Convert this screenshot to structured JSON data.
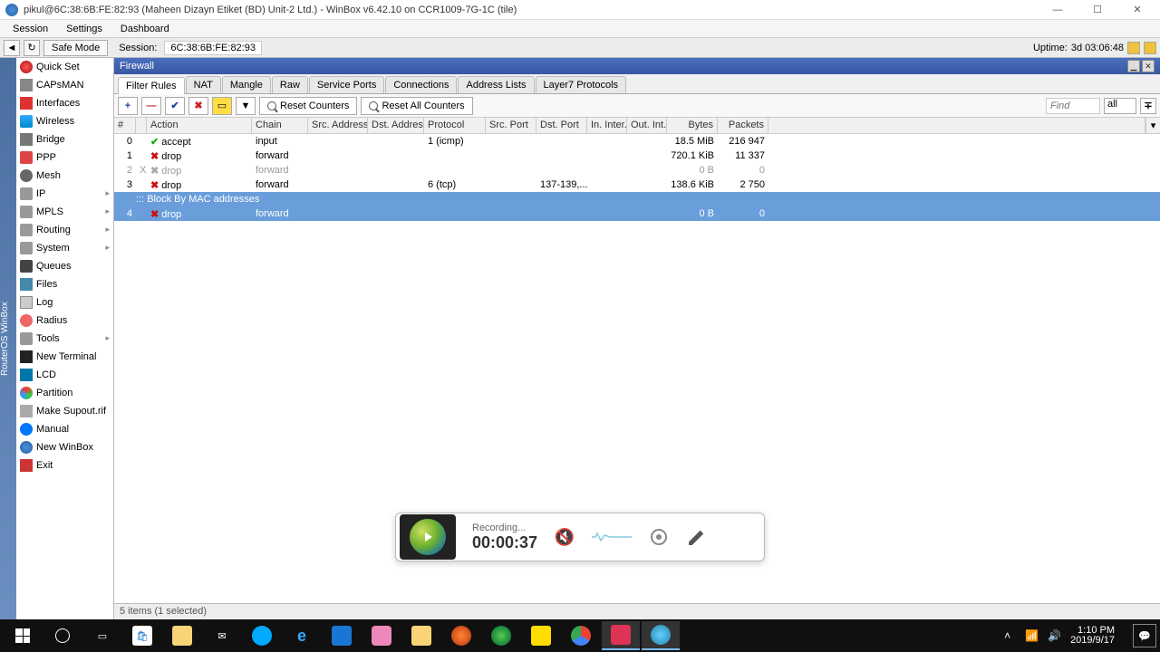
{
  "titlebar": {
    "text": "pikul@6C:38:6B:FE:82:93 (Maheen Dizayn Etiket (BD) Unit-2 Ltd.) - WinBox v6.42.10 on CCR1009-7G-1C (tile)"
  },
  "menu": {
    "session": "Session",
    "settings": "Settings",
    "dashboard": "Dashboard"
  },
  "session": {
    "safemode": "Safe Mode",
    "label": "Session:",
    "value": "6C:38:6B:FE:82:93",
    "uptime_label": "Uptime:",
    "uptime_value": "3d 03:06:48"
  },
  "vert_label": "RouterOS  WinBox",
  "sidebar": {
    "items": [
      {
        "label": "Quick Set",
        "cls": "ico-qset"
      },
      {
        "label": "CAPsMAN",
        "cls": "ico-caps"
      },
      {
        "label": "Interfaces",
        "cls": "ico-intf"
      },
      {
        "label": "Wireless",
        "cls": "ico-wifi"
      },
      {
        "label": "Bridge",
        "cls": "ico-bridge"
      },
      {
        "label": "PPP",
        "cls": "ico-ppp"
      },
      {
        "label": "Mesh",
        "cls": "ico-mesh"
      },
      {
        "label": "IP",
        "cls": "ico-ip",
        "arrow": true
      },
      {
        "label": "MPLS",
        "cls": "ico-mpls",
        "arrow": true
      },
      {
        "label": "Routing",
        "cls": "ico-routing",
        "arrow": true
      },
      {
        "label": "System",
        "cls": "ico-system",
        "arrow": true
      },
      {
        "label": "Queues",
        "cls": "ico-queue"
      },
      {
        "label": "Files",
        "cls": "ico-files"
      },
      {
        "label": "Log",
        "cls": "ico-log"
      },
      {
        "label": "Radius",
        "cls": "ico-radius"
      },
      {
        "label": "Tools",
        "cls": "ico-tools",
        "arrow": true
      },
      {
        "label": "New Terminal",
        "cls": "ico-term"
      },
      {
        "label": "LCD",
        "cls": "ico-lcd"
      },
      {
        "label": "Partition",
        "cls": "ico-part"
      },
      {
        "label": "Make Supout.rif",
        "cls": "ico-supout"
      },
      {
        "label": "Manual",
        "cls": "ico-manual"
      },
      {
        "label": "New WinBox",
        "cls": "ico-newwb"
      },
      {
        "label": "Exit",
        "cls": "ico-exit"
      }
    ]
  },
  "firewall": {
    "title": "Firewall",
    "tabs": [
      "Filter Rules",
      "NAT",
      "Mangle",
      "Raw",
      "Service Ports",
      "Connections",
      "Address Lists",
      "Layer7 Protocols"
    ],
    "active_tab": 0,
    "toolbar": {
      "reset": "Reset Counters",
      "reset_all": "Reset All Counters",
      "find_ph": "Find",
      "all": "all"
    },
    "columns": [
      "#",
      "",
      "Action",
      "Chain",
      "Src. Address",
      "Dst. Address",
      "Protocol",
      "Src. Port",
      "Dst. Port",
      "In. Inter...",
      "Out. Int...",
      "Bytes",
      "Packets"
    ],
    "rows": [
      {
        "num": "0",
        "x": "",
        "act": "accept",
        "chain": "input",
        "saddr": "",
        "daddr": "",
        "proto": "1 (icmp)",
        "sport": "",
        "dport": "",
        "inif": "",
        "outif": "",
        "bytes": "18.5 MiB",
        "packets": "216 947",
        "disabled": false
      },
      {
        "num": "1",
        "x": "",
        "act": "drop",
        "chain": "forward",
        "saddr": "",
        "daddr": "",
        "proto": "",
        "sport": "",
        "dport": "",
        "inif": "",
        "outif": "",
        "bytes": "720.1 KiB",
        "packets": "11 337",
        "disabled": false
      },
      {
        "num": "2",
        "x": "X",
        "act": "drop",
        "chain": "forward",
        "saddr": "",
        "daddr": "",
        "proto": "",
        "sport": "",
        "dport": "",
        "inif": "",
        "outif": "",
        "bytes": "0 B",
        "packets": "0",
        "disabled": true
      },
      {
        "num": "3",
        "x": "",
        "act": "drop",
        "chain": "forward",
        "saddr": "",
        "daddr": "",
        "proto": "6 (tcp)",
        "sport": "",
        "dport": "137-139,...",
        "inif": "",
        "outif": "",
        "bytes": "138.6 KiB",
        "packets": "2 750",
        "disabled": false
      }
    ],
    "comment": "::: Block By MAC addresses",
    "selected_row": {
      "num": "4",
      "x": "",
      "act": "drop",
      "chain": "forward",
      "saddr": "",
      "daddr": "",
      "proto": "",
      "sport": "",
      "dport": "",
      "inif": "",
      "outif": "",
      "bytes": "0 B",
      "packets": "0"
    },
    "status": "5 items (1 selected)"
  },
  "recorder": {
    "label": "Recording...",
    "time": "00:00:37"
  },
  "taskbar": {
    "time": "1:10 PM",
    "date": "2019/9/17"
  }
}
